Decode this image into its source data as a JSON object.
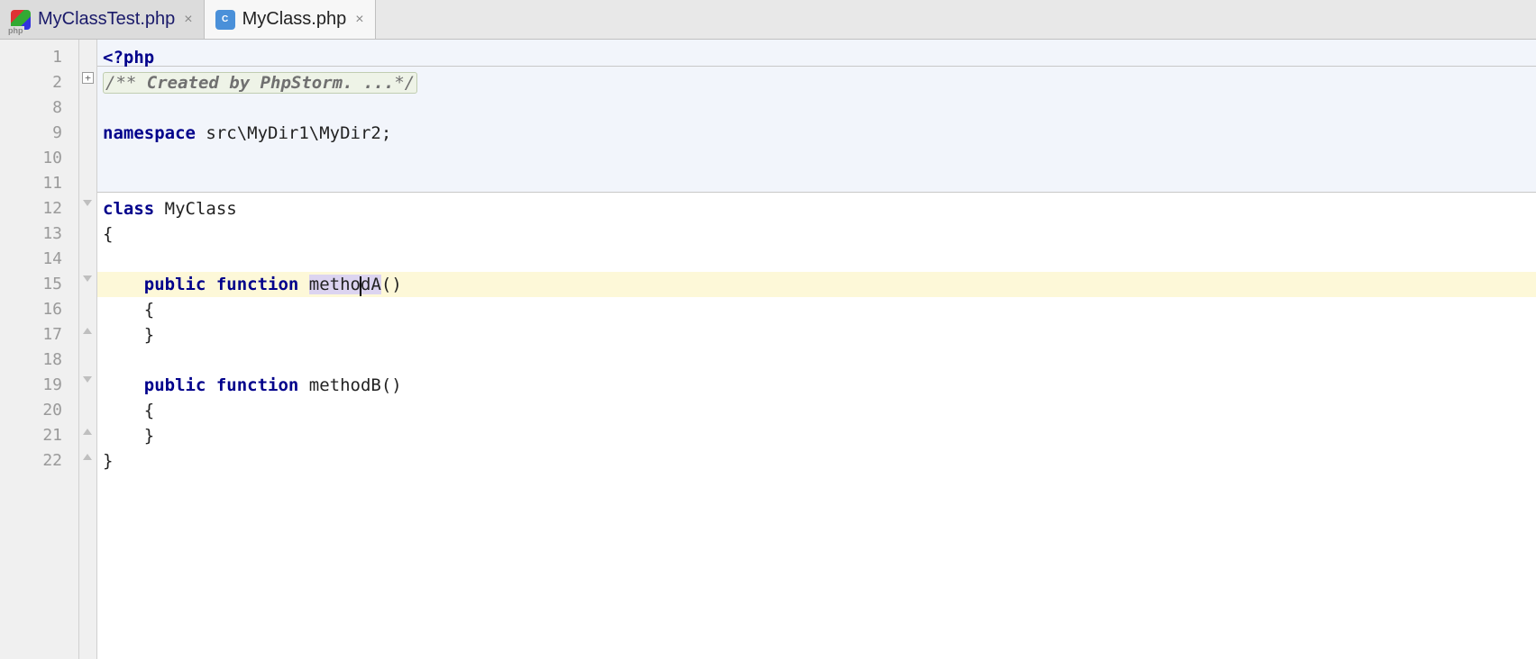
{
  "tabs": [
    {
      "label": "MyClassTest.php",
      "active": false,
      "iconType": "php-test"
    },
    {
      "label": "MyClass.php",
      "active": true,
      "iconType": "class",
      "iconLetter": "C"
    }
  ],
  "gutterNumbers": [
    "1",
    "2",
    "8",
    "9",
    "10",
    "11",
    "12",
    "13",
    "14",
    "15",
    "16",
    "17",
    "18",
    "19",
    "20",
    "21",
    "22"
  ],
  "code": {
    "l1_open": "<?php",
    "l2_cmt_prefix": "/** ",
    "l2_cmt_body": "Created by PhpStorm. ...",
    "l2_cmt_suffix": "*/",
    "l9_kw": "namespace",
    "l9_rest": " src\\MyDir1\\MyDir2;",
    "l12_kw": "class",
    "l12_name": " MyClass",
    "l13": "{",
    "l15_pub": "public",
    "l15_func": " function ",
    "l15_m_pre": "metho",
    "l15_m_post": "dA",
    "l15_paren": "()",
    "l16": "    {",
    "l17": "    }",
    "l19_pub": "public",
    "l19_func": " function ",
    "l19_name": "methodB()",
    "l20": "    {",
    "l21": "    }",
    "l22": "}"
  }
}
